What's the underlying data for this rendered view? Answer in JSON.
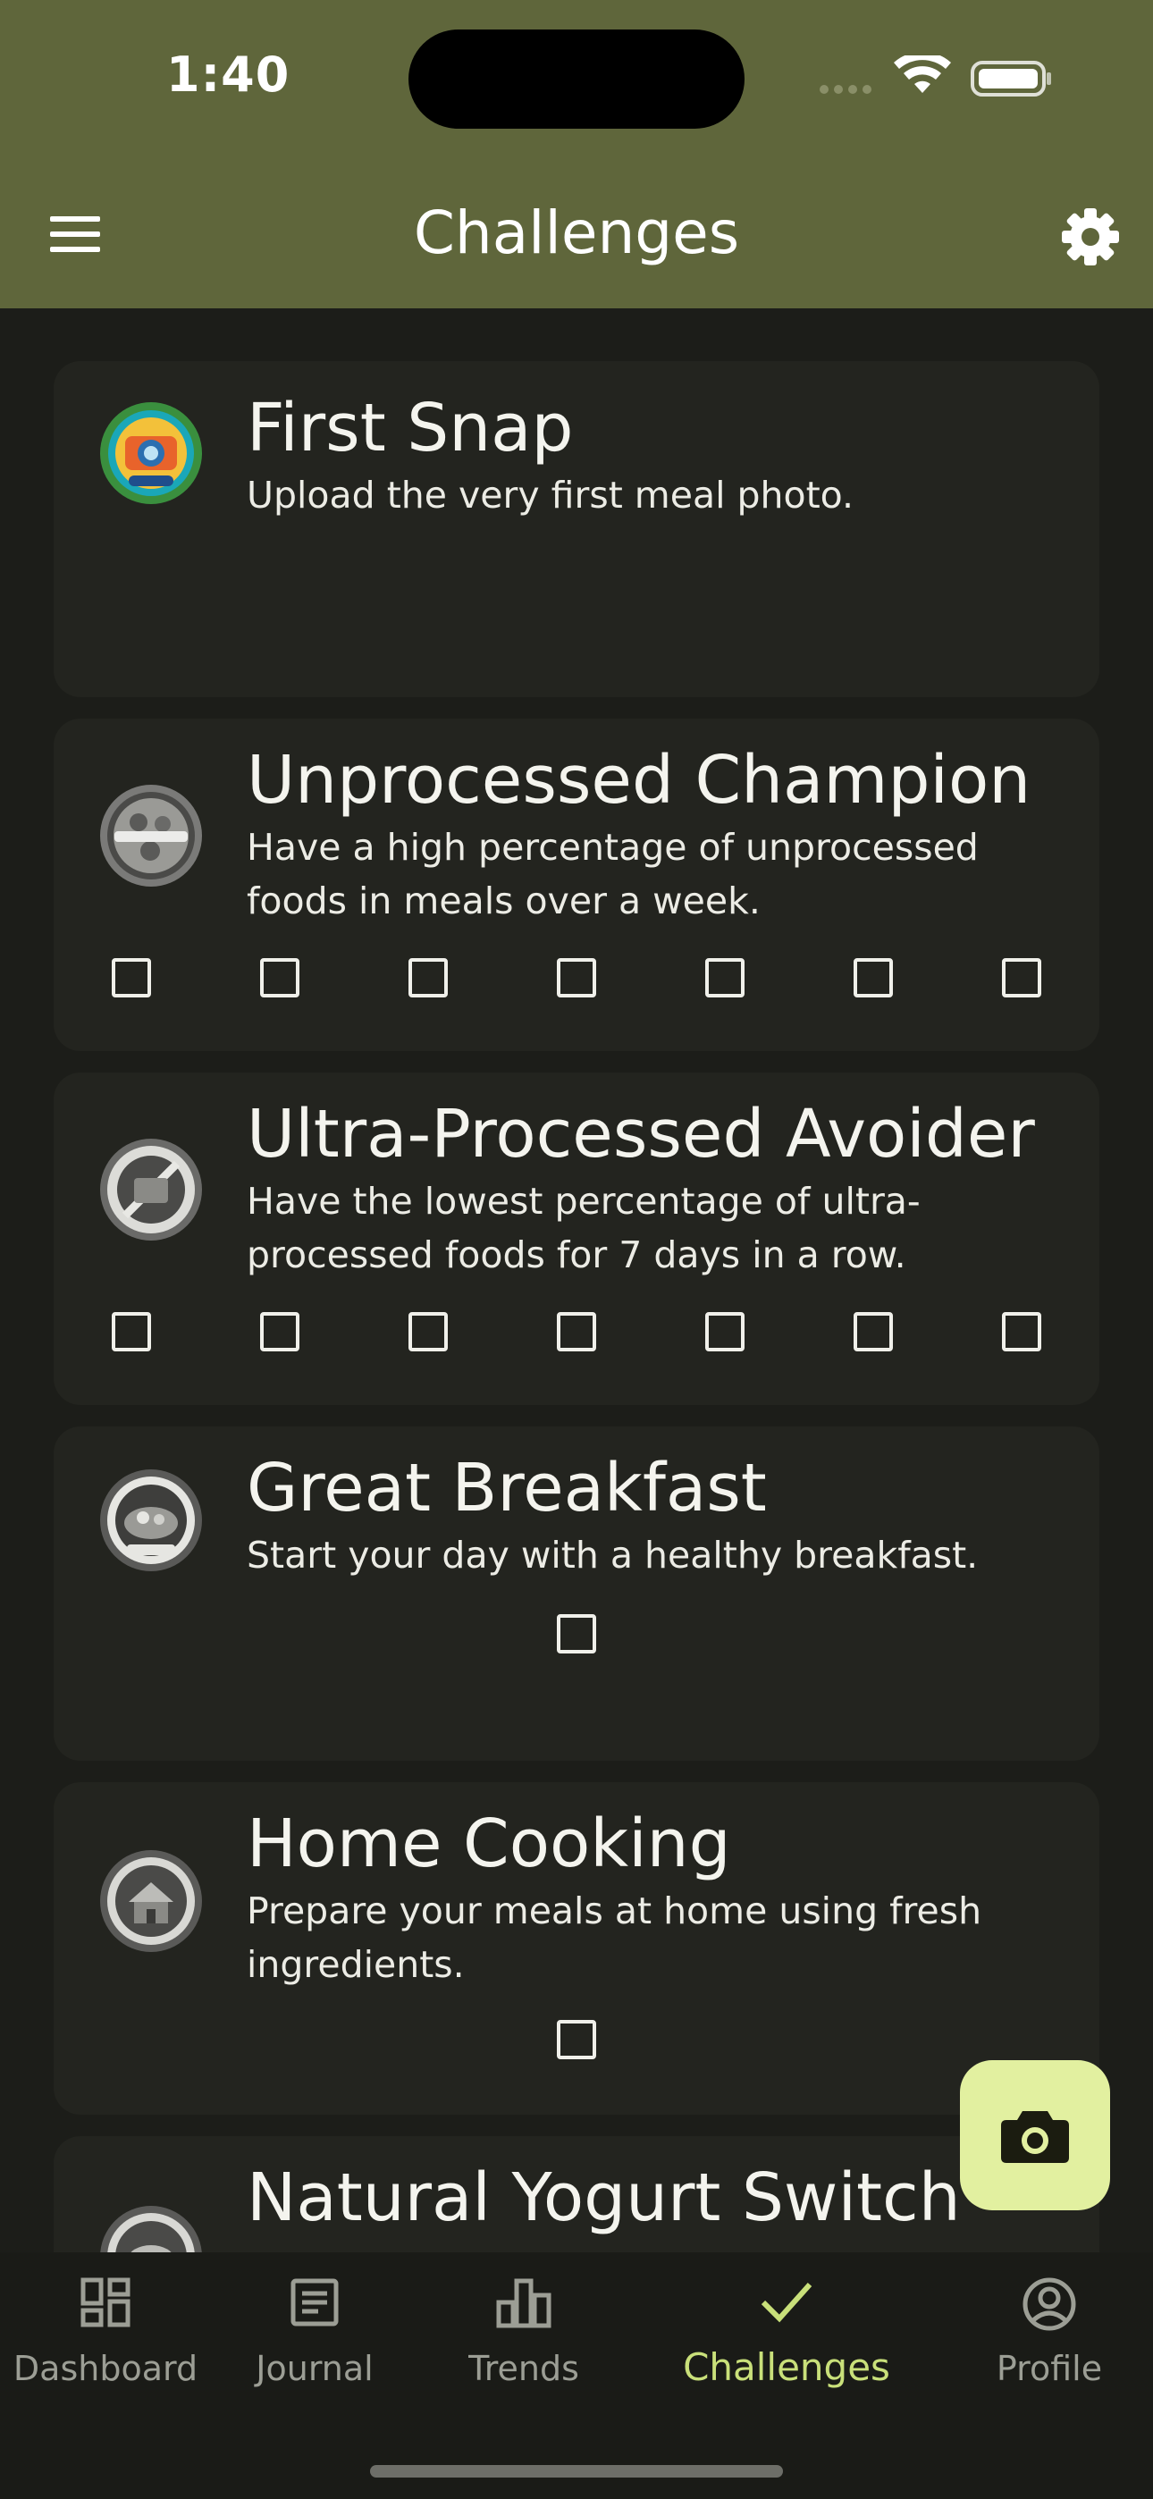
{
  "status_bar": {
    "time": "1:40"
  },
  "app_bar": {
    "title": "Challenges"
  },
  "challenges": [
    {
      "title": "First Snap",
      "description": "Upload the very first meal photo.",
      "checkboxes": 0
    },
    {
      "title": "Unprocessed Champion",
      "description": "Have a high percentage of unprocessed foods in meals over a week.",
      "checkboxes": 7
    },
    {
      "title": "Ultra-Processed Avoider",
      "description": "Have the lowest percentage of ultra-processed foods for 7 days in a row.",
      "checkboxes": 7
    },
    {
      "title": "Great Breakfast",
      "description": "Start your day with a healthy breakfast.",
      "checkboxes": 1
    },
    {
      "title": "Home Cooking",
      "description": "Prepare your meals at home using fresh ingredients.",
      "checkboxes": 1
    },
    {
      "title": "Natural Yogurt Switch",
      "description": "",
      "checkboxes": 0
    }
  ],
  "bottom_nav": {
    "items": [
      {
        "label": "Dashboard",
        "icon": "dashboard-icon"
      },
      {
        "label": "Journal",
        "icon": "journal-icon"
      },
      {
        "label": "Trends",
        "icon": "trends-icon"
      },
      {
        "label": "Challenges",
        "icon": "check-icon",
        "active": true
      },
      {
        "label": "Profile",
        "icon": "profile-icon"
      }
    ]
  },
  "colors": {
    "header": "#5f663b",
    "background": "#1c1d19",
    "card": "#23241f",
    "accent": "#c9e07a",
    "fab": "#e2f0a0"
  }
}
